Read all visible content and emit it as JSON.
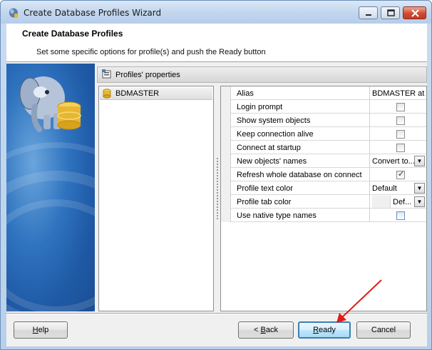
{
  "window": {
    "title": "Create Database Profiles Wizard"
  },
  "header": {
    "title": "Create Database Profiles",
    "subtitle": "Set some specific options for profile(s) and push the Ready button"
  },
  "panel": {
    "title": "Profiles' properties"
  },
  "profiles": [
    {
      "label": "BDMASTER",
      "icon": "database-icon"
    }
  ],
  "properties": [
    {
      "name": "Alias",
      "type": "text",
      "value": "BDMASTER at ..."
    },
    {
      "name": "Login prompt",
      "type": "checkbox",
      "checked": false
    },
    {
      "name": "Show system objects",
      "type": "checkbox",
      "checked": false
    },
    {
      "name": "Keep connection alive",
      "type": "checkbox",
      "checked": false
    },
    {
      "name": "Connect at startup",
      "type": "checkbox",
      "checked": false
    },
    {
      "name": "New objects' names",
      "type": "dropdown",
      "value": "Convert to..."
    },
    {
      "name": "Refresh whole database on connect",
      "type": "checkbox",
      "checked": true
    },
    {
      "name": "Profile text color",
      "type": "dropdown",
      "value": "Default"
    },
    {
      "name": "Profile tab color",
      "type": "color-dropdown",
      "value": "Def..."
    },
    {
      "name": "Use native type names",
      "type": "checkbox",
      "checked": false
    }
  ],
  "buttons": {
    "help": {
      "pre": "",
      "accel": "H",
      "post": "elp"
    },
    "back": {
      "pre": "< ",
      "accel": "B",
      "post": "ack"
    },
    "ready": {
      "pre": "",
      "accel": "R",
      "post": "eady"
    },
    "cancel": {
      "pre": "",
      "accel": "",
      "post": "Cancel"
    }
  },
  "colors": {
    "accent": "#3c7fb1",
    "annotation_arrow": "#e01b1b"
  }
}
